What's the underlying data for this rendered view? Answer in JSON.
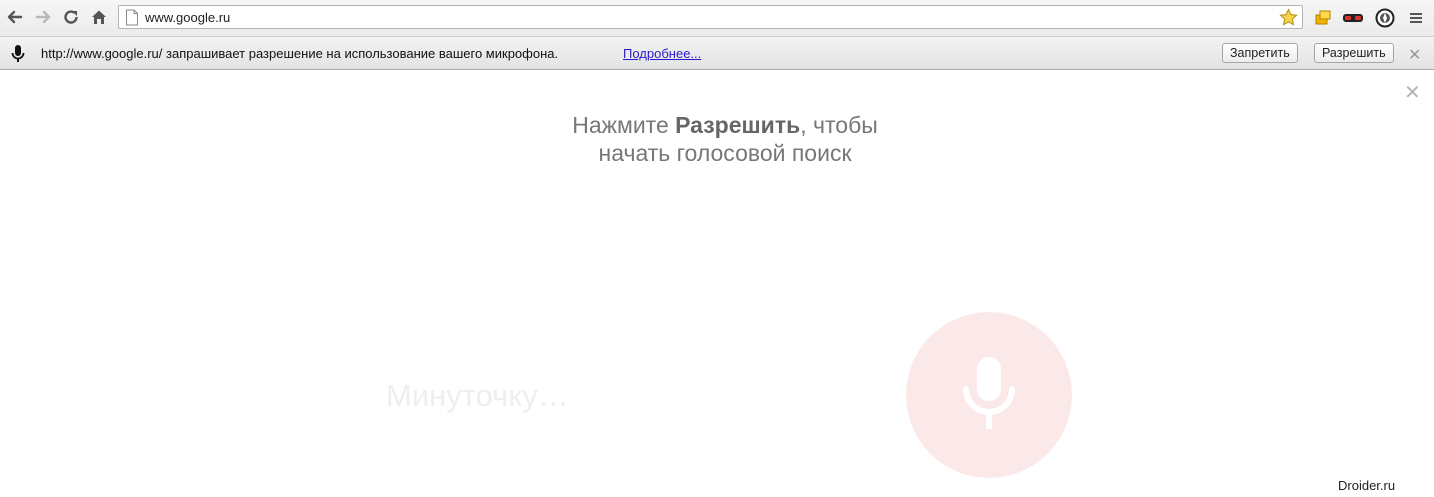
{
  "browser": {
    "url": "www.google.ru"
  },
  "infobar": {
    "message": "http://www.google.ru/ запрашивает разрешение на использование вашего микрофона.",
    "learn_more": "Подробнее...",
    "deny_label": "Запретить",
    "allow_label": "Разрешить",
    "close_glyph": "✕"
  },
  "page": {
    "close_glyph": "✕",
    "prompt_before": "Нажмите ",
    "prompt_bold": "Разрешить",
    "prompt_after": ", чтобы",
    "prompt_line2": "начать голосовой поиск",
    "wait_text": "Минуточку…",
    "watermark": "Droider.ru"
  },
  "colors": {
    "mic_circle": "#fbe9e9",
    "link": "#2b19c9"
  }
}
